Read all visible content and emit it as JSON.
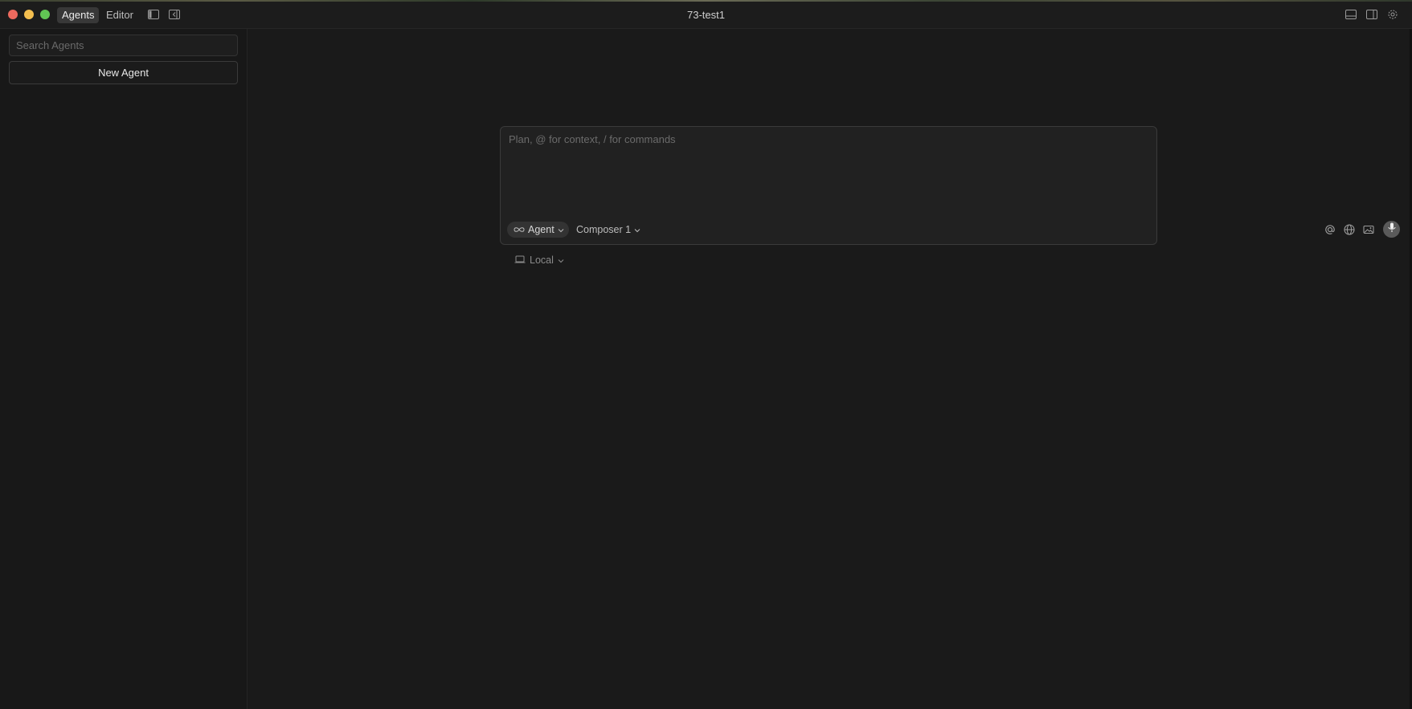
{
  "window": {
    "title": "73-test1"
  },
  "titlebar": {
    "tabs": [
      {
        "label": "Agents",
        "active": true
      },
      {
        "label": "Editor",
        "active": false
      }
    ],
    "left_icons": [
      "sidebar-toggle-icon",
      "back-panel-icon"
    ],
    "right_icons": [
      "bottom-panel-icon",
      "right-panel-icon",
      "gear-icon"
    ]
  },
  "sidebar": {
    "search_placeholder": "Search Agents",
    "new_agent_label": "New Agent"
  },
  "composer": {
    "placeholder": "Plan, @ for context, / for commands",
    "mode_label": "Agent",
    "mode_icon": "infinity-icon",
    "model_label": "Composer 1",
    "action_icons": [
      "at-sign-icon",
      "globe-icon",
      "image-icon",
      "microphone-icon"
    ],
    "location_label": "Local",
    "location_icon": "laptop-icon"
  },
  "colors": {
    "background": "#1a1a1a",
    "sidebar": "#181818",
    "composer_bg": "#212121",
    "close": "#ed6a5e",
    "minimize": "#f4bf4f",
    "maximize": "#61c554"
  }
}
